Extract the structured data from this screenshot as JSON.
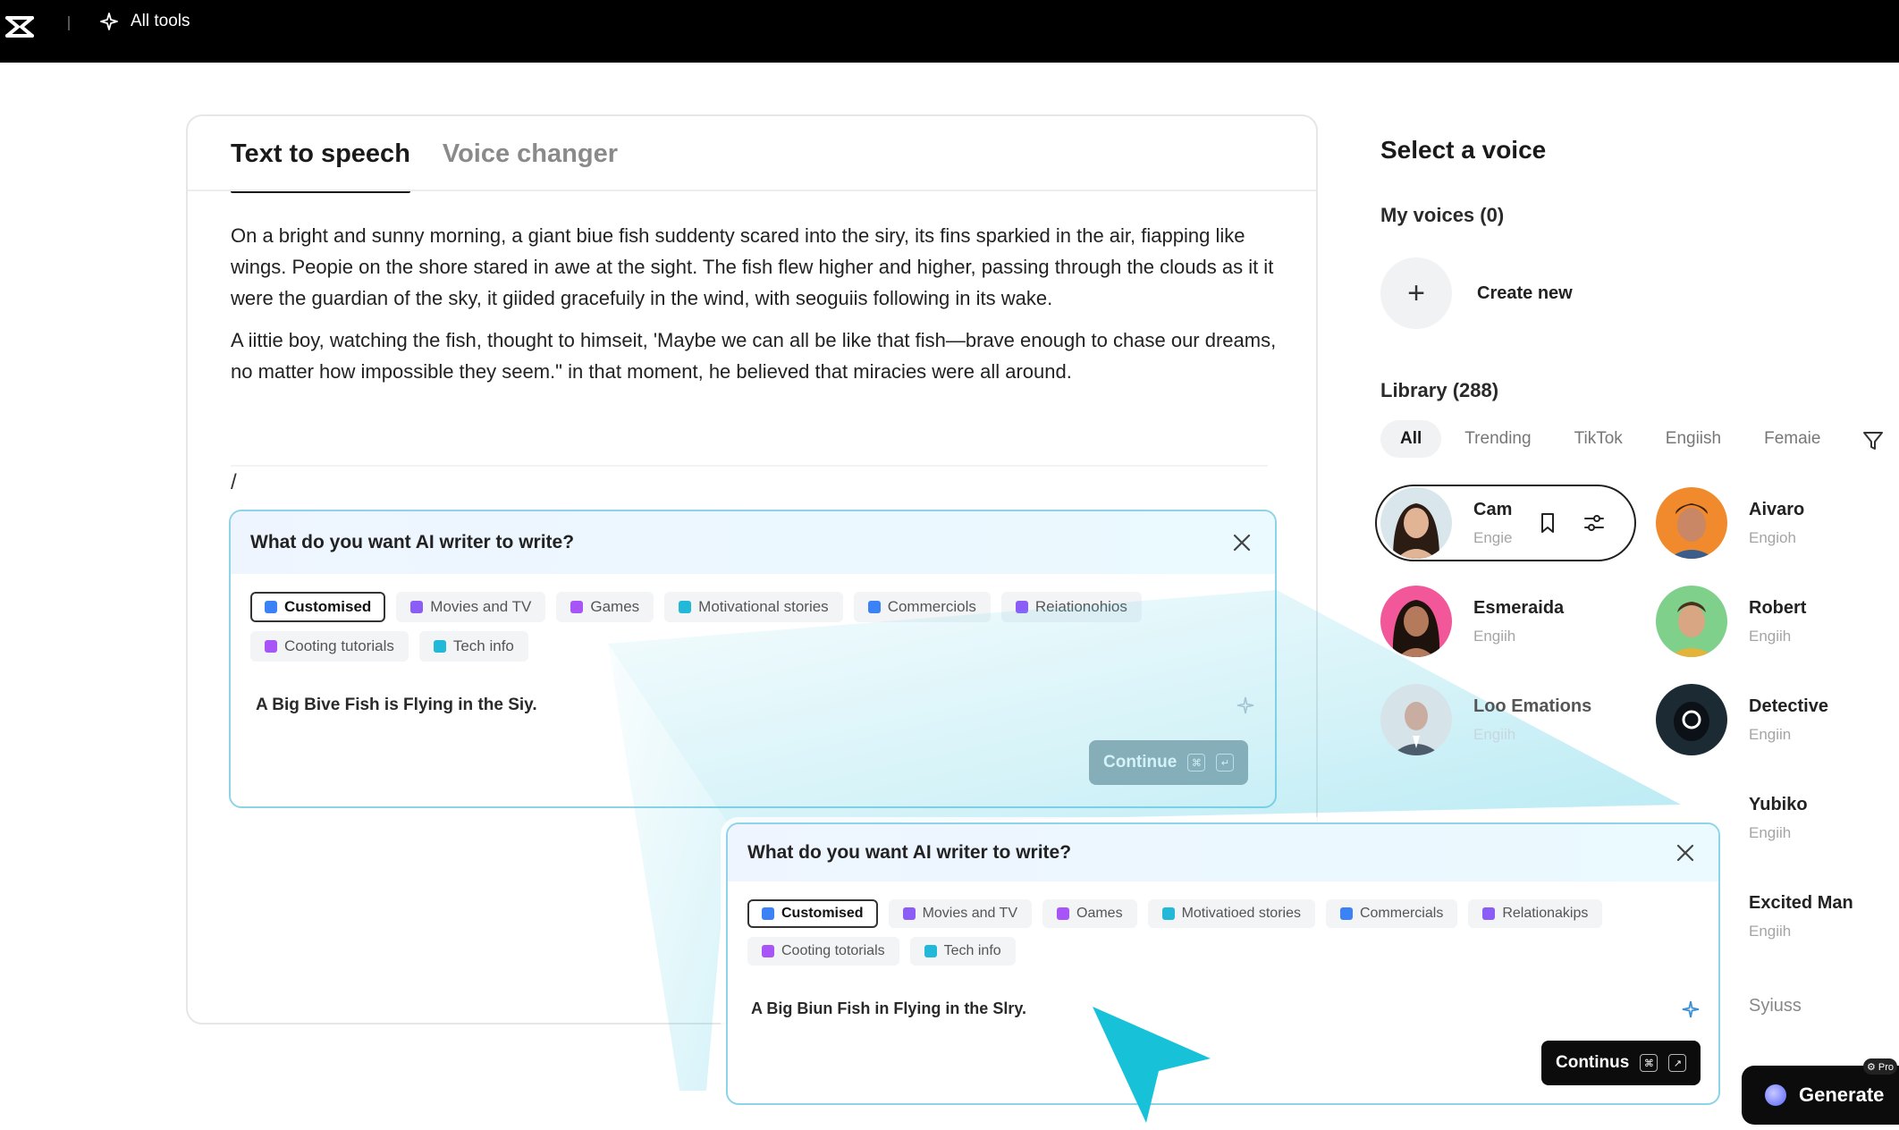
{
  "topbar": {
    "tools_label": "All tools"
  },
  "editor": {
    "tabs": [
      {
        "label": "Text to speech",
        "active": true
      },
      {
        "label": "Voice changer",
        "active": false
      }
    ],
    "paragraphs": [
      "On a bright and sunny morning, a giant biue fish suddenty scared into the siry, its fins sparkied in the air, fiapping like wings. Peopie on the shore stared in awe at the sight. The fish flew higher and higher, passing through the clouds as it it were the guardian of the sky, it giided gracefuily in the wind, with seoguiis following in its wake.",
      "A iittie boy, watching the fish, thought to himseit, 'Maybe we can all be like that fish—brave enough to chase our dreams, no matter how impossible they seem.\" in that moment, he believed that miracies were all around."
    ],
    "caret": "/"
  },
  "writer_back": {
    "title": "What do you want AI writer to write?",
    "chips": [
      "Customised",
      "Movies and TV",
      "Games",
      "Motivational stories",
      "Commerciols",
      "Reiationohios",
      "Cooting tutorials",
      "Tech info"
    ],
    "prompt": "A Big Bive Fish is Flying in the Siy.",
    "continue_label": "Continue",
    "kbd1": "⌘",
    "kbd2": "↵"
  },
  "writer_front": {
    "title": "What do you want AI writer to write?",
    "chips": [
      "Customised",
      "Movies and TV",
      "Oames",
      "Motivatioed stories",
      "Commercials",
      "Relationakips",
      "Cooting totorials",
      "Tech info"
    ],
    "prompt": "A Big Biun Fish in Flying in the Slry.",
    "continue_label": "Continus",
    "kbd1": "⌘",
    "kbd2": "↗"
  },
  "voices": {
    "title": "Select a voice",
    "my_voices": "My voices (0)",
    "create_label": "Create new",
    "library": "Library (288)",
    "filters": [
      "All",
      "Trending",
      "TikTok",
      "Engiish",
      "Femaie"
    ],
    "list": [
      {
        "name": "Cam",
        "lang": "Engie",
        "selected": true
      },
      {
        "name": "Aivaro",
        "lang": "Engioh"
      },
      {
        "name": "Esmeraida",
        "lang": "Engiih"
      },
      {
        "name": "Robert",
        "lang": "Engiih"
      },
      {
        "name": "Loo Emations",
        "lang": "Engiih"
      },
      {
        "name": "Detective",
        "lang": "Engiin"
      },
      {
        "name": "Yubiko",
        "lang": "Engiih"
      },
      {
        "name": "Excited Man",
        "lang": "Engiih"
      },
      {
        "name": "Syiuss",
        "lang": ""
      }
    ]
  },
  "generate": {
    "label": "Generate",
    "badge": "⚙ Pro"
  },
  "colors": {
    "accent_border": "#8fd3e8",
    "beam": "#3cc6e0",
    "pointer": "#17c1d8",
    "dark_button": "#0c0c0c"
  }
}
